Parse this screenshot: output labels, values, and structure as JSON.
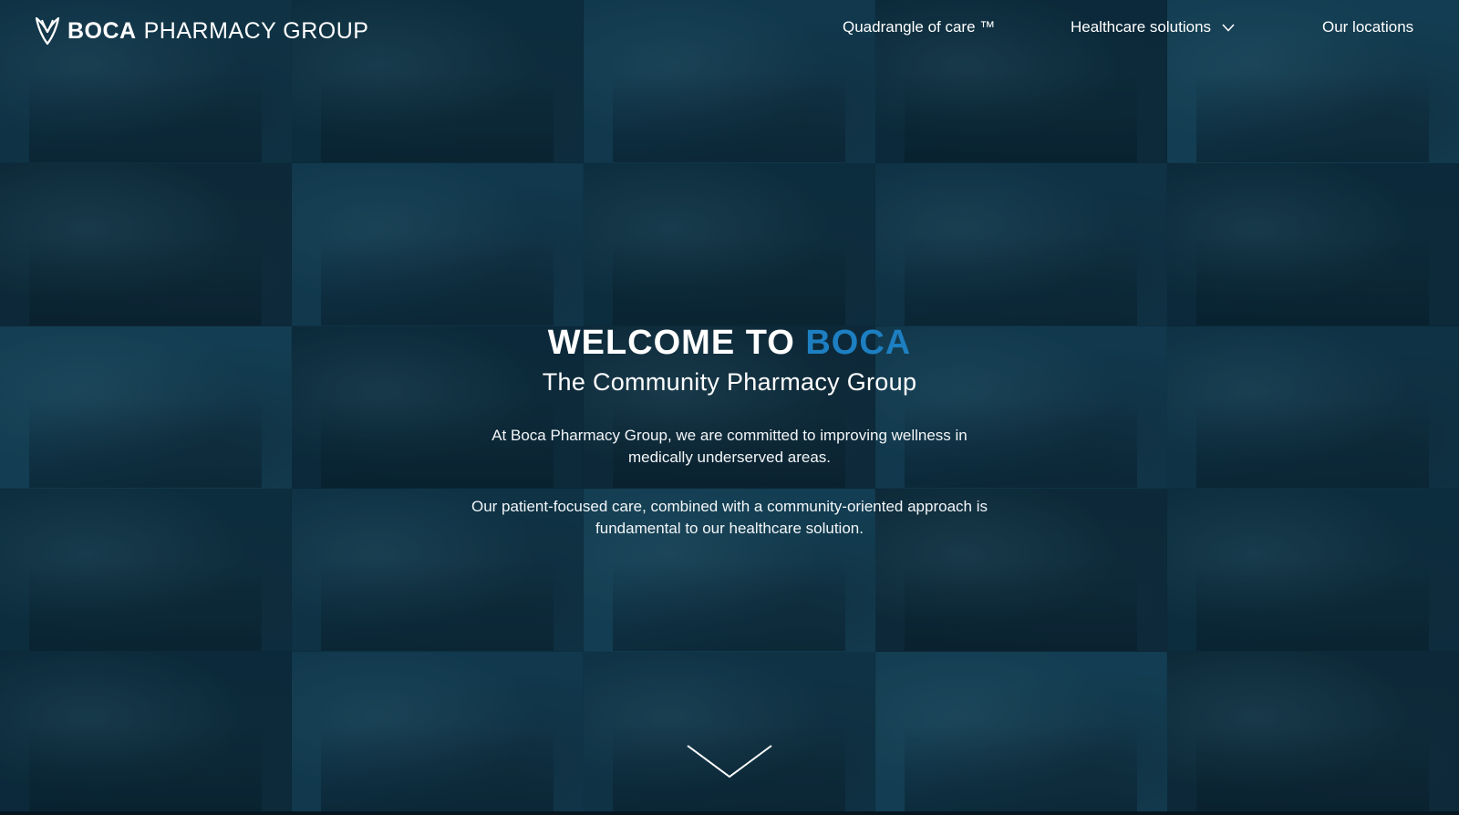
{
  "brand": {
    "name_bold": "BOCA",
    "name_light": "PHARMACY GROUP",
    "logo_icon": "shield-leaf-icon"
  },
  "nav": {
    "items": [
      {
        "label": "Quadrangle of care ™"
      },
      {
        "label": "Healthcare solutions",
        "icon": "chevron-down-icon"
      },
      {
        "label": "Our locations"
      }
    ]
  },
  "hero": {
    "title_prefix": "WELCOME TO ",
    "title_accent": "BOCA",
    "subtitle": "The Community Pharmacy Group",
    "paragraph_1": "At Boca Pharmacy Group, we are committed to improving wellness in medically underserved areas.",
    "paragraph_2": "Our patient-focused care, combined with a community-oriented approach is fundamental to our healthcare solution.",
    "scroll_icon": "chevron-down-icon"
  },
  "colors": {
    "background_tint": "#0c2a3a",
    "accent_blue": "#1d7fc1",
    "text_white": "#ffffff"
  }
}
